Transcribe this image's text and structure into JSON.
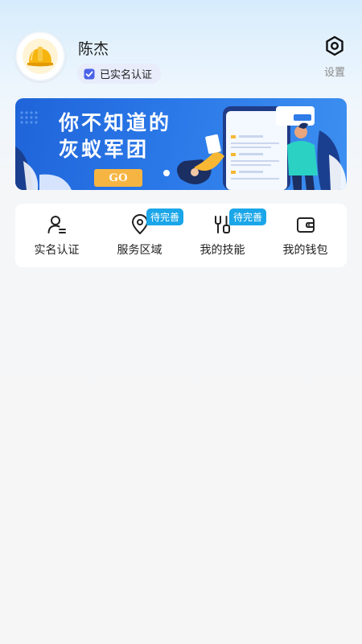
{
  "profile": {
    "name": "陈杰",
    "verified_label": "已实名认证",
    "avatar_icon": "hard-hat-icon"
  },
  "settings": {
    "label": "设置",
    "icon": "settings-hexagon-icon"
  },
  "banner": {
    "title_line1": "你不知道的",
    "title_line2": "灰蚁军团",
    "button_label": "GO"
  },
  "quick_actions": [
    {
      "label": "实名认证",
      "icon": "user-id-icon",
      "badge": ""
    },
    {
      "label": "服务区域",
      "icon": "location-pin-icon",
      "badge": "待完善"
    },
    {
      "label": "我的技能",
      "icon": "tools-icon",
      "badge": "待完善"
    },
    {
      "label": "我的钱包",
      "icon": "wallet-icon",
      "badge": ""
    }
  ],
  "colors": {
    "accent_blue": "#1aa6e8",
    "badge_bg": "#e8ecfb",
    "hat_yellow": "#f6b40e"
  }
}
